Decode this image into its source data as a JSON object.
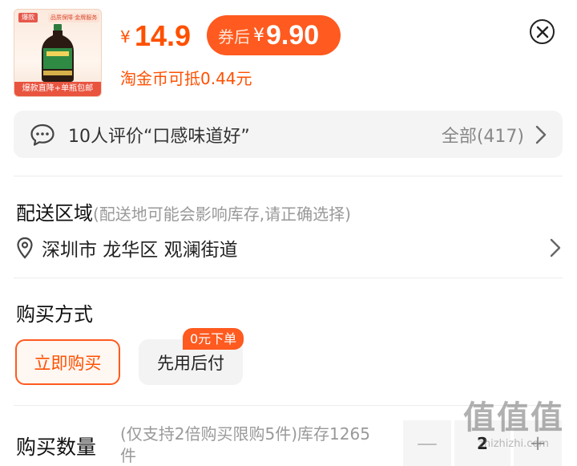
{
  "product": {
    "thumb_tag": "爆款",
    "thumb_tag2": "品质保障·金牌服务",
    "thumb_label": "味极鲜",
    "thumb_banner": "爆款直降+单瓶包邮"
  },
  "price": {
    "currency": "¥",
    "current": "14.9",
    "coupon_label": "券后",
    "coupon_currency": "¥",
    "coupon_value": "9.90",
    "coin_text": "淘金币可抵0.44元"
  },
  "reviews": {
    "summary": "10人评价“口感味道好”",
    "all_label": "全部(417)"
  },
  "delivery": {
    "title": "配送区域",
    "hint": "(配送地可能会影响库存,请正确选择)",
    "address": "深圳市 龙华区 观澜街道"
  },
  "purchase_method": {
    "title": "购买方式",
    "options": [
      {
        "label": "立即购买",
        "selected": true
      },
      {
        "label": "先用后付",
        "selected": false,
        "badge": "0元下单"
      }
    ]
  },
  "quantity": {
    "title": "购买数量",
    "hint": "(仅支持2倍购买限购5件)库存1265件",
    "minus": "—",
    "value": "2",
    "plus": "+"
  },
  "watermark": {
    "big": "值值值",
    "small": "zhizhizhi.com"
  },
  "colors": {
    "accent": "#ff5000",
    "accent_bg": "#ff5a1f",
    "panel_bg": "#f4f4f4"
  }
}
